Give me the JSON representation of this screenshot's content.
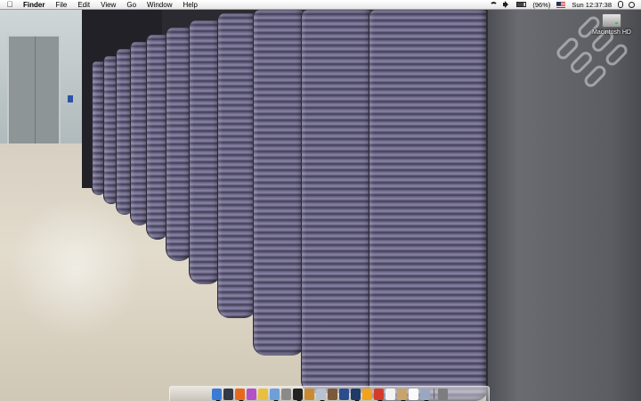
{
  "menubar": {
    "app_name": "Finder",
    "menus": [
      "File",
      "Edit",
      "View",
      "Go",
      "Window",
      "Help"
    ],
    "battery_percent": "(96%)",
    "clock": "Sun 12:37:38"
  },
  "desktop": {
    "icons": [
      {
        "label": "Macintosh HD",
        "icon": "hard-drive-icon"
      }
    ]
  },
  "dock": {
    "items": [
      {
        "name": "finder",
        "color": "#3b7bd6",
        "running": true
      },
      {
        "name": "dashboard",
        "color": "#333a44",
        "running": false
      },
      {
        "name": "firefox",
        "color": "#e66a1e",
        "running": true
      },
      {
        "name": "itunes",
        "color": "#b34fc9",
        "running": false
      },
      {
        "name": "chat",
        "color": "#e8c040",
        "running": false
      },
      {
        "name": "preview",
        "color": "#6f9fd8",
        "running": true
      },
      {
        "name": "system-preferences",
        "color": "#8a8a8a",
        "running": false
      },
      {
        "name": "terminal",
        "color": "#222222",
        "running": true
      },
      {
        "name": "textedit",
        "color": "#c98b2f",
        "running": false
      },
      {
        "name": "photo-viewer",
        "color": "#b9c3cf",
        "running": true
      },
      {
        "name": "address-book",
        "color": "#7a5a3a",
        "running": false
      },
      {
        "name": "dictionary",
        "color": "#2b4d8c",
        "running": false
      },
      {
        "name": "photoshop",
        "color": "#1f3b66",
        "running": true
      },
      {
        "name": "stickies",
        "color": "#f2a31a",
        "running": false
      },
      {
        "name": "mail",
        "color": "#d43b2a",
        "running": true
      },
      {
        "name": "ical",
        "color": "#f2f2f2",
        "running": false
      },
      {
        "name": "tools",
        "color": "#c8a46a",
        "running": true
      },
      {
        "name": "x11",
        "color": "#fafafa",
        "running": false
      },
      {
        "name": "expose",
        "color": "#9aa7c0",
        "running": true
      },
      {
        "name": "trash",
        "color": "#7d7d7d",
        "running": false
      }
    ]
  }
}
